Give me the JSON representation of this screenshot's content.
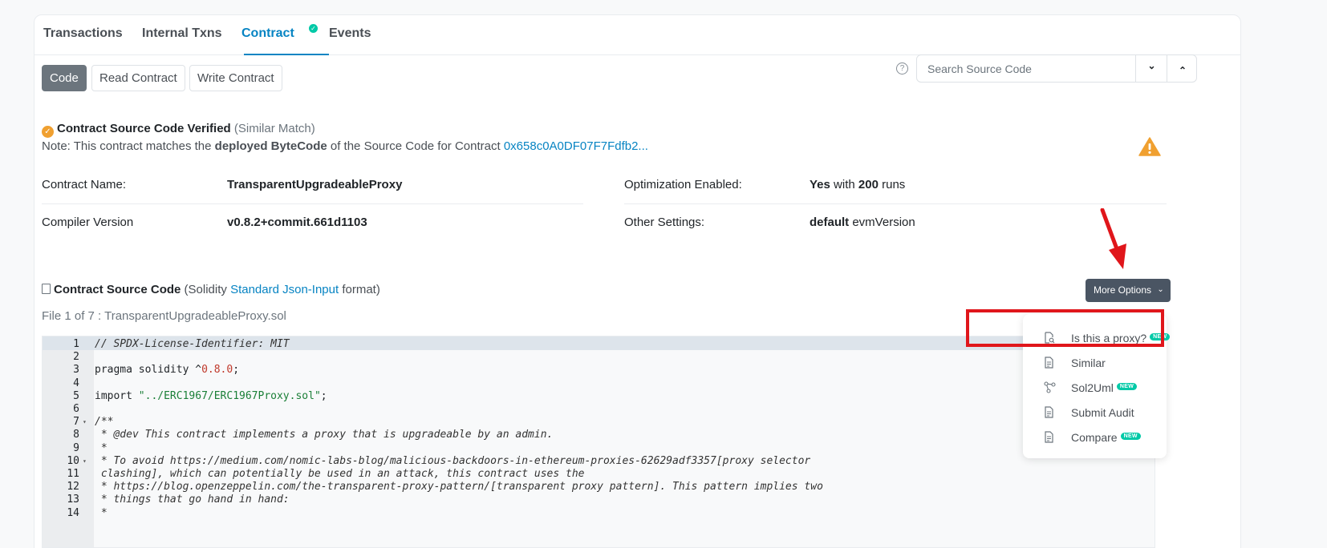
{
  "tabs": [
    {
      "label": "Transactions",
      "active": false
    },
    {
      "label": "Internal Txns",
      "active": false
    },
    {
      "label": "Contract",
      "active": true,
      "verified_mark": "✓"
    },
    {
      "label": "Events",
      "active": false
    }
  ],
  "subtabs": {
    "code": "Code",
    "read": "Read Contract",
    "write": "Write Contract"
  },
  "search": {
    "placeholder": "Search Source Code",
    "help_icon_glyph": "?",
    "down_glyph": "⌄",
    "up_glyph": "⌃"
  },
  "verification": {
    "title": "Contract Source Code Verified",
    "match": "(Similar Match)",
    "note_prefix": "Note: This contract matches the",
    "note_bold": "deployed ByteCode",
    "note_middle": "of the Source Code for Contract",
    "note_link": "0x658c0A0DF07F7Fdfb2..."
  },
  "details": {
    "contract_name_label": "Contract Name:",
    "contract_name_value": "TransparentUpgradeableProxy",
    "compiler_label": "Compiler Version",
    "compiler_value": "v0.8.2+commit.661d1103",
    "optimization_label": "Optimization Enabled:",
    "optimization_yes": "Yes",
    "optimization_with": "with",
    "optimization_runs": "200",
    "optimization_runs_suffix": "runs",
    "settings_label": "Other Settings:",
    "settings_bold": "default",
    "settings_value": "evmVersion"
  },
  "source": {
    "title": "Contract Source Code",
    "paren_open": "(Solidity",
    "format_link": "Standard Json-Input",
    "paren_close": "format)",
    "more_options": "More Options",
    "more_chevron": "⌄",
    "file_label": "File 1 of 7 : TransparentUpgradeableProxy.sol"
  },
  "code_lines": [
    {
      "n": "1",
      "text": "// SPDX-License-Identifier: MIT"
    },
    {
      "n": "2",
      "text": ""
    },
    {
      "n": "3",
      "text": "pragma solidity ^",
      "num": "0.8.0",
      "after": ";"
    },
    {
      "n": "4",
      "text": ""
    },
    {
      "n": "5",
      "text": "import ",
      "str": "\"../ERC1967/ERC1967Proxy.sol\"",
      "after": ";"
    },
    {
      "n": "6",
      "text": ""
    },
    {
      "n": "7",
      "text": "/**"
    },
    {
      "n": "8",
      "text": " * @dev This contract implements a proxy that is upgradeable by an admin."
    },
    {
      "n": "9",
      "text": " *"
    },
    {
      "n": "10",
      "text": " * To avoid https://medium.com/nomic-labs-blog/malicious-backdoors-in-ethereum-proxies-62629adf3357[proxy selector"
    },
    {
      "n": "11",
      "text": " clashing], which can potentially be used in an attack, this contract uses the"
    },
    {
      "n": "12",
      "text": " * https://blog.openzeppelin.com/the-transparent-proxy-pattern/[transparent proxy pattern]. This pattern implies two"
    },
    {
      "n": "13",
      "text": " * things that go hand in hand:"
    },
    {
      "n": "14",
      "text": " *"
    }
  ],
  "fold_glyph": "▾",
  "menu": [
    {
      "label": "Is this a proxy?",
      "badge": "NEW",
      "icon": "file-search-icon"
    },
    {
      "label": "Similar",
      "badge": "",
      "icon": "file-icon"
    },
    {
      "label": "Sol2Uml",
      "badge": "NEW",
      "icon": "diagram-icon"
    },
    {
      "label": "Submit Audit",
      "badge": "",
      "icon": "file-icon"
    },
    {
      "label": "Compare",
      "badge": "NEW",
      "icon": "file-icon"
    }
  ],
  "colors": {
    "accent": "#0784c3",
    "annotation_red": "#e0161b",
    "badge_green": "#00c9a7",
    "warning_orange": "#f0a030"
  }
}
